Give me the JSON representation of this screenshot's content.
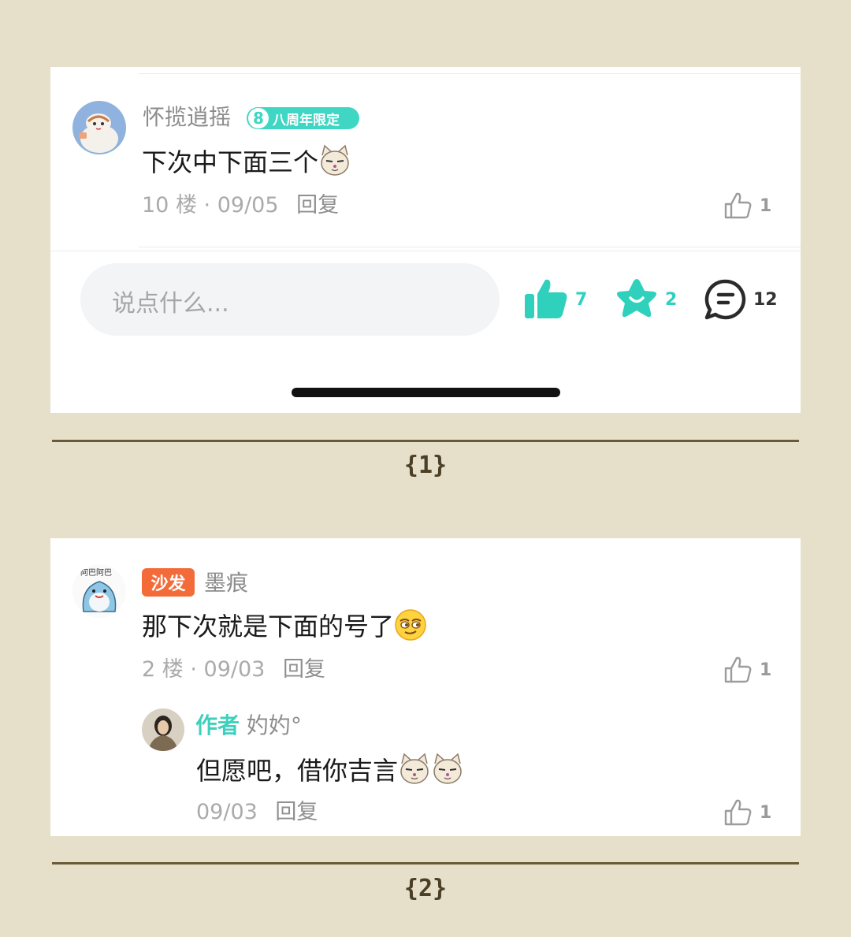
{
  "screenshot1": {
    "comment": {
      "username": "怀揽逍摇",
      "badge_number": "8",
      "badge_text": "八周年限定",
      "content": "下次中下面三个",
      "floor": "10 楼",
      "date": "09/05",
      "reply_label": "回复",
      "likes": "1"
    },
    "bottom_bar": {
      "input_placeholder": "说点什么...",
      "like_count": "7",
      "star_count": "2",
      "comment_count": "12"
    },
    "page_label": "{1}"
  },
  "screenshot2": {
    "comment": {
      "sofa_tag": "沙发",
      "username": "墨痕",
      "content": "那下次就是下面的号了",
      "floor": "2 楼",
      "date": "09/03",
      "reply_label": "回复",
      "likes": "1"
    },
    "reply": {
      "author_tag": "作者",
      "username": "妁妁°",
      "content": "但愿吧，借你吉言",
      "date": "09/03",
      "reply_label": "回复",
      "likes": "1"
    },
    "page_label": "{2}"
  },
  "colors": {
    "background": "#e6dfca",
    "accent": "#3fd6c3",
    "sofa": "#f46b3a",
    "separator": "#6b5a3a"
  }
}
